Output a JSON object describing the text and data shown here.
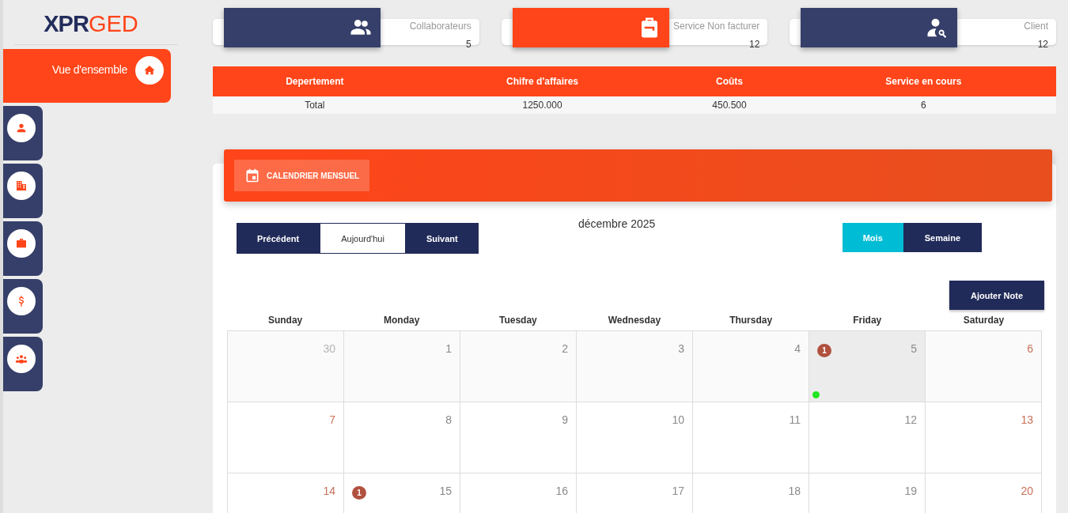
{
  "logo": {
    "primary": "XPR",
    "secondary": "GED"
  },
  "nav": [
    {
      "kind": "home",
      "label": "Vue d'ensemble",
      "selected": true
    },
    {
      "kind": "person",
      "selected": false
    },
    {
      "kind": "building",
      "selected": false
    },
    {
      "kind": "briefcase",
      "selected": false
    },
    {
      "kind": "dollar",
      "selected": false
    },
    {
      "kind": "group",
      "selected": false
    }
  ],
  "stats": [
    {
      "kind": "people",
      "label": "Collaborateurs",
      "value": "5",
      "color": "#353f69"
    },
    {
      "kind": "bag",
      "label": "Service Non facturer",
      "value": "12",
      "color": "#ff4519"
    },
    {
      "kind": "user-search",
      "label": "Client",
      "value": "12",
      "color": "#353f69"
    }
  ],
  "table": {
    "columns": [
      "Depertement",
      "Chifre d'affaires",
      "Coûts",
      "Service en cours"
    ],
    "rows": [
      [
        "Total",
        "1250.000",
        "450.500",
        "6"
      ]
    ]
  },
  "calendar": {
    "title": "CALENDRIER MENSUEL",
    "month_label": "décembre 2025",
    "nav_buttons": [
      {
        "label": "Précédent",
        "selected": false
      },
      {
        "label": "Aujourd'hui",
        "selected": true
      },
      {
        "label": "Suivant",
        "selected": false
      }
    ],
    "view_buttons": [
      {
        "label": "Mois",
        "selected": true
      },
      {
        "label": "Semaine",
        "selected": false
      }
    ],
    "add_button": "Ajouter Note",
    "weekdays": [
      "Sunday",
      "Monday",
      "Tuesday",
      "Wednesday",
      "Thursday",
      "Friday",
      "Saturday"
    ],
    "weeks": [
      [
        {
          "day": "30",
          "kind": "outside",
          "selected": false
        },
        {
          "day": "1",
          "kind": "weekday",
          "selected": false
        },
        {
          "day": "2",
          "kind": "weekday",
          "selected": false
        },
        {
          "day": "3",
          "kind": "weekday",
          "selected": false
        },
        {
          "day": "4",
          "kind": "weekday",
          "selected": false
        },
        {
          "day": "5",
          "kind": "weekday",
          "selected": true,
          "badge": "1",
          "dot": true
        },
        {
          "day": "6",
          "kind": "weekend",
          "selected": false
        }
      ],
      [
        {
          "day": "7",
          "kind": "weekend",
          "selected": false
        },
        {
          "day": "8",
          "kind": "weekday",
          "selected": false
        },
        {
          "day": "9",
          "kind": "weekday",
          "selected": false
        },
        {
          "day": "10",
          "kind": "weekday",
          "selected": false
        },
        {
          "day": "11",
          "kind": "weekday",
          "selected": false
        },
        {
          "day": "12",
          "kind": "weekday",
          "selected": false
        },
        {
          "day": "13",
          "kind": "weekend",
          "selected": false
        }
      ],
      [
        {
          "day": "14",
          "kind": "weekend",
          "selected": false
        },
        {
          "day": "15",
          "kind": "weekday",
          "selected": false,
          "badge": "1"
        },
        {
          "day": "16",
          "kind": "weekday",
          "selected": false
        },
        {
          "day": "17",
          "kind": "weekday",
          "selected": false
        },
        {
          "day": "18",
          "kind": "weekday",
          "selected": false
        },
        {
          "day": "19",
          "kind": "weekday",
          "selected": false
        },
        {
          "day": "20",
          "kind": "weekend",
          "selected": false
        }
      ]
    ]
  }
}
